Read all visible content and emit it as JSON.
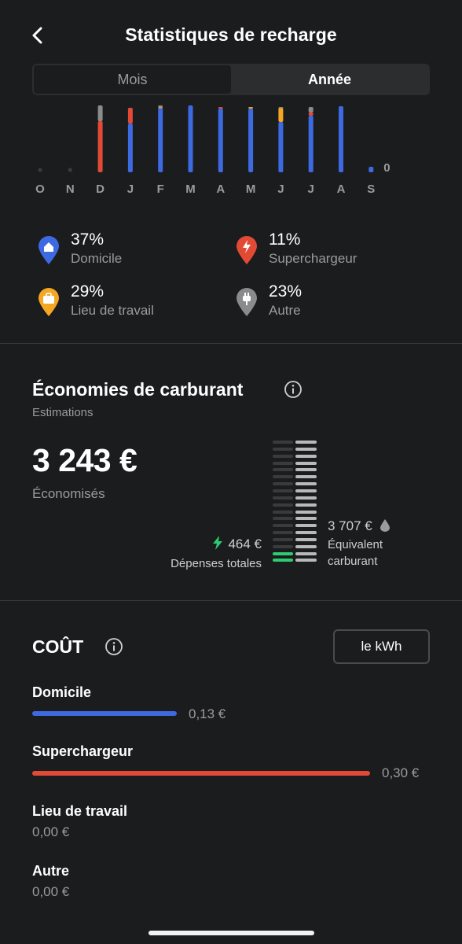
{
  "header": {
    "title": "Statistiques de recharge"
  },
  "period_tabs": [
    {
      "label": "Mois",
      "selected": false
    },
    {
      "label": "Année",
      "selected": true
    }
  ],
  "chart_data": {
    "type": "bar",
    "stacked": true,
    "categories": [
      "O",
      "N",
      "D",
      "J",
      "F",
      "M",
      "A",
      "M",
      "J",
      "J",
      "A",
      "S"
    ],
    "series": [
      {
        "name": "Domicile",
        "color": "#3e6ae1",
        "values": [
          0,
          0,
          0,
          62,
          82,
          85,
          81,
          81,
          64,
          72,
          84,
          7
        ]
      },
      {
        "name": "Superchargeur",
        "color": "#e24a35",
        "values": [
          0,
          0,
          65,
          20,
          0,
          0,
          2,
          0,
          0,
          4,
          0,
          0
        ]
      },
      {
        "name": "Lieu de travail",
        "color": "#f5a623",
        "values": [
          0,
          0,
          0,
          0,
          1,
          0,
          0,
          2,
          18,
          0,
          0,
          0
        ]
      },
      {
        "name": "Autre",
        "color": "#8a8b8d",
        "values": [
          0,
          0,
          20,
          0,
          2,
          0,
          0,
          0,
          1,
          7,
          0,
          0
        ]
      }
    ],
    "ylim": [
      0,
      85
    ],
    "annotations": [
      {
        "category_index": 11,
        "text": "0"
      }
    ]
  },
  "legend": [
    {
      "pct": "37%",
      "label": "Domicile",
      "color": "#3e6ae1",
      "icon": "home-icon"
    },
    {
      "pct": "11%",
      "label": "Superchargeur",
      "color": "#e24a35",
      "icon": "bolt-icon"
    },
    {
      "pct": "29%",
      "label": "Lieu de travail",
      "color": "#f5a623",
      "icon": "briefcase-icon"
    },
    {
      "pct": "23%",
      "label": "Autre",
      "color": "#8a8b8d",
      "icon": "plug-icon"
    }
  ],
  "savings": {
    "title": "Économies de carburant",
    "subtitle": "Estimations",
    "amount": "3 243 €",
    "amount_label": "Économisés",
    "spend_value": "464 €",
    "spend_label": "Dépenses totales",
    "fuel_value": "3 707 €",
    "fuel_label_1": "Équivalent",
    "fuel_label_2": "carburant"
  },
  "cost": {
    "title": "COÛT",
    "unit_button": "le kWh",
    "items": [
      {
        "label": "Domicile",
        "value": "0,13 €",
        "fraction": 0.13,
        "color": "#3e6ae1"
      },
      {
        "label": "Superchargeur",
        "value": "0,30 €",
        "fraction": 0.3,
        "color": "#e24a35"
      },
      {
        "label": "Lieu de travail",
        "value": "0,00 €",
        "fraction": 0,
        "color": "#f5a623"
      },
      {
        "label": "Autre",
        "value": "0,00 €",
        "fraction": 0,
        "color": "#8a8b8d"
      }
    ]
  },
  "colors": {
    "background": "#1b1c1e",
    "green": "#2ecc71"
  }
}
